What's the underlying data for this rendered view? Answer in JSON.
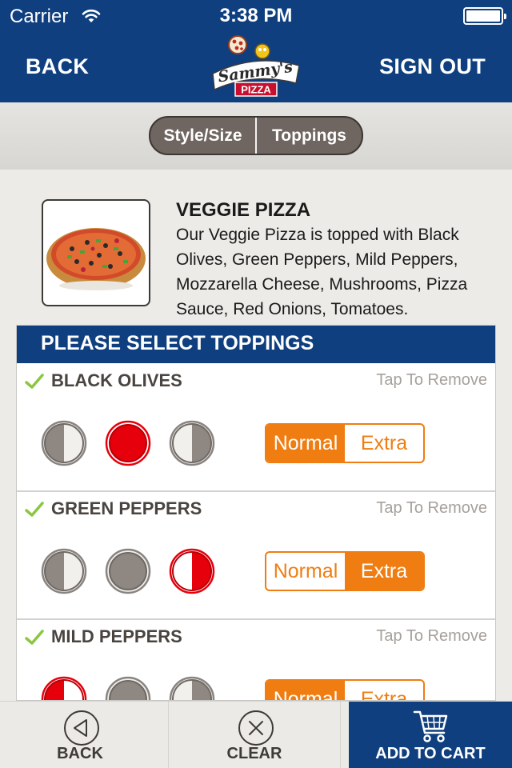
{
  "status_bar": {
    "carrier": "Carrier",
    "time": "3:38 PM"
  },
  "nav": {
    "back_label": "BACK",
    "signout_label": "SIGN OUT",
    "logo_text": "Sammy's",
    "logo_subtext": "PIZZA"
  },
  "tabs": [
    {
      "label": "Style/Size",
      "selected": false
    },
    {
      "label": "Toppings",
      "selected": true
    }
  ],
  "pizza": {
    "title": "VEGGIE PIZZA",
    "description": "Our Veggie Pizza is topped with Black Olives, Green Peppers, Mild Peppers, Mozzarella Cheese, Mushrooms, Pizza Sauce, Red Onions, Tomatoes."
  },
  "toppings_section": {
    "heading": "PLEASE SELECT TOPPINGS",
    "items": [
      {
        "name": "BLACK OLIVES",
        "action": "Tap To Remove",
        "placement": "whole",
        "amount": "Normal"
      },
      {
        "name": "GREEN PEPPERS",
        "action": "Tap To Remove",
        "placement": "right",
        "amount": "Extra"
      },
      {
        "name": "MILD PEPPERS",
        "action": "Tap To Remove",
        "placement": "left",
        "amount": "Normal"
      }
    ],
    "amount_options": [
      "Normal",
      "Extra"
    ]
  },
  "bottom_bar": {
    "back_label": "BACK",
    "clear_label": "CLEAR",
    "cart_label": "ADD TO CART"
  },
  "colors": {
    "brand_blue": "#0f3f7f",
    "accent_orange": "#ef7d12",
    "selected_red": "#e5000b"
  }
}
